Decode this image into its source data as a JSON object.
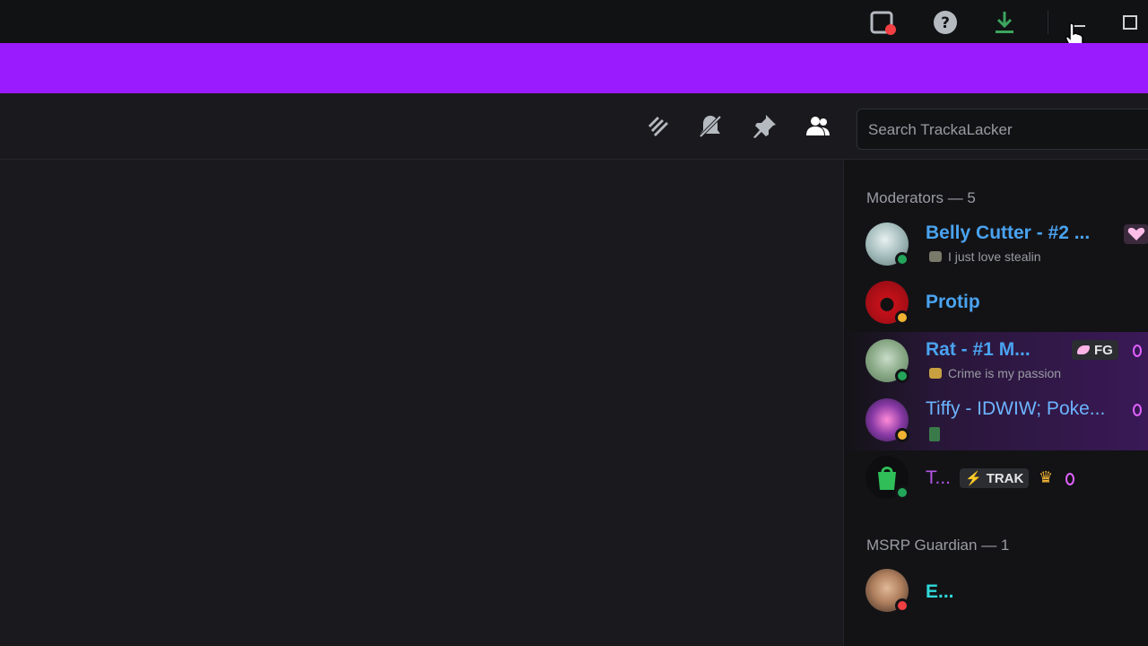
{
  "titlebar": {
    "icons": [
      "inbox-alert-icon",
      "help-icon",
      "download-icon",
      "minimize-icon",
      "maximize-icon"
    ]
  },
  "channel_header": {
    "icons": [
      "threads-icon",
      "mute-notifications-icon",
      "pin-icon",
      "member-list-icon"
    ],
    "search_placeholder": "Search TrackaLacker"
  },
  "members": {
    "sections": [
      {
        "header": "Moderators — 5",
        "items": [
          {
            "name": "Belly Cutter - #2 ...",
            "status_text": "I just love stealin",
            "presence": "online",
            "name_color": "#4aa3f0"
          },
          {
            "name": "Protip",
            "status_text": "",
            "presence": "idle",
            "name_color": "#4aa3f0"
          },
          {
            "name": "Rat - #1 M...",
            "status_text": "Crime is my passion",
            "presence": "online",
            "name_color": "#4aa3f0",
            "tag": "FG"
          },
          {
            "name": "Tiffy - IDWIW; Poke...",
            "status_text": "",
            "presence": "idle",
            "name_color": "#6cb4ff"
          },
          {
            "name": "T...",
            "status_text": "",
            "presence": "online",
            "name_color": "#b455e6",
            "tag": "TRAK"
          }
        ]
      },
      {
        "header": "MSRP Guardian — 1",
        "items": [
          {
            "name": "E...",
            "status_text": "",
            "presence": "dnd",
            "name_color": "#2fd8d8"
          }
        ]
      }
    ]
  },
  "colors": {
    "banner": "#9b1bff",
    "online": "#23a55a",
    "idle": "#f0b232",
    "dnd": "#f23f43"
  }
}
